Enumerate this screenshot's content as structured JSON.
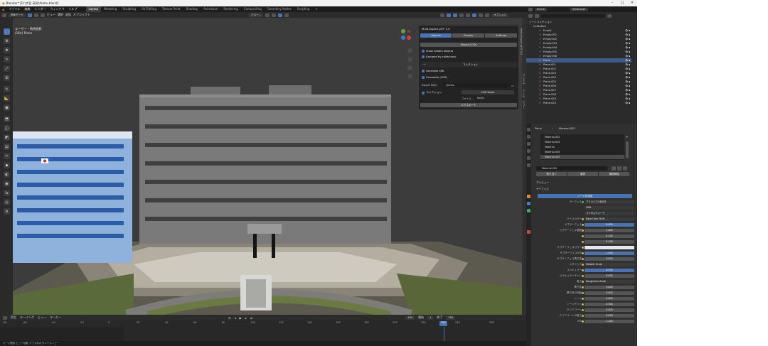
{
  "window": {
    "title": "Blender* [D:\\大宮 高岡\\fonbu.blend]"
  },
  "menu": {
    "items": [
      "ファイル",
      "編集",
      "レンダー",
      "ウィンドウ",
      "ヘルプ"
    ]
  },
  "workspaces": [
    "Layout",
    "Modeling",
    "Sculpting",
    "UV Editing",
    "Texture Paint",
    "Shading",
    "Animation",
    "Rendering",
    "Compositing",
    "Geometry Nodes",
    "Scripting"
  ],
  "header": {
    "mode": "物体モード",
    "menus": [
      "ビュー",
      "選択",
      "追加",
      "オブジェクト"
    ],
    "transform": "グロー...",
    "options": "オプション"
  },
  "viewport": {
    "view_name": "ユーザー・透視投影",
    "object_name": "(164) Plane"
  },
  "addon": {
    "title": "Multi-Export glTF 2.0",
    "tabs": [
      "Objects",
      "Presets",
      "Settings"
    ],
    "reload_button": "Reload LODs",
    "show_hidden": "Show hidden objects",
    "grouped": "Grouped by collections",
    "collection_header": "コレクション",
    "generate_xml": "Generate XML",
    "overwrite": "Overwrite (LOD)",
    "export_path_label": "Export Path:",
    "export_path": "//fonbu",
    "collection_label": "コレクション",
    "collection_value": "LOD Value",
    "file_label": "ファイル...",
    "file_value": "fonbu",
    "export_button": "エクスポート"
  },
  "sidebar_tabs": [
    "Multi-Export glTF 2.0",
    "アイテム",
    "ツール",
    "ビュー"
  ],
  "timeline": {
    "menus": [
      "再生",
      "キーイング",
      "ビュー",
      "マーカー"
    ],
    "ticks": [
      "-80",
      "-60",
      "-40",
      "-20",
      "0",
      "20",
      "40",
      "60",
      "80",
      "100",
      "120",
      "140",
      "160",
      "180",
      "200",
      "220",
      "240",
      "260"
    ],
    "current_frame": "164",
    "start_label": "開始",
    "start": "1",
    "end_label": "終了",
    "end": "250"
  },
  "statusbar": {
    "text": "ループ選択          ビュー回転          マウス右ボタンでメニュー"
  },
  "outliner": {
    "scene": "Scene",
    "view_layer": "ViewLayer",
    "root": "シーンコレクション",
    "collection": "Collection",
    "rows": [
      "Empty",
      "Empty.001",
      "Empty.002",
      "Empty.003",
      "Empty.004",
      "Empty.005",
      "Empty.006",
      "Plane",
      "Plane.001",
      "Plane.002",
      "Plane.003",
      "Plane.004",
      "Plane.005",
      "Plane.006",
      "Plane.007",
      "Plane.008",
      "Plane.009",
      "Plane.010"
    ],
    "selected_index": 7
  },
  "properties": {
    "breadcrumb_object": "Plane",
    "breadcrumb_material": "Material.005",
    "material_slots": [
      "Material.002",
      "Material.003",
      "Material",
      "Material.004",
      "Material.005"
    ],
    "material_name": "Material.005",
    "buttons": [
      "割り当て",
      "選択",
      "選択解除"
    ],
    "preview": "プレビュー",
    "surface_section": "サーフェス",
    "use_nodes": "ノードを使用",
    "surface_label": "サーフェス",
    "surface_value": "プリンシプルBSDF",
    "dist1": "GGX",
    "dist2": "ランダムウォーク",
    "rows": [
      {
        "label": "ベースカラー",
        "value": "Base Color RGB"
      },
      {
        "label": "サブサーフェス",
        "value": "0.000"
      },
      {
        "label": "サブサーフェス範囲",
        "value": "1.000"
      },
      {
        "label": "",
        "value": "0.200"
      },
      {
        "label": "",
        "value": "0.100"
      },
      {
        "label": "サブサーフェスカラー",
        "value": ""
      },
      {
        "label": "サブサーフェスIOR",
        "value": "1.400"
      },
      {
        "label": "サブサーフェス異方性",
        "value": "0.000"
      },
      {
        "label": "メタリック",
        "value": "Metallic Scale"
      },
      {
        "label": "スペキュラー",
        "value": "0.500"
      },
      {
        "label": "スペキュラーチント",
        "value": "0.000"
      },
      {
        "label": "粗さ",
        "value": "Roughness Scale"
      },
      {
        "label": "異方性",
        "value": "0.000"
      },
      {
        "label": "異方性の回転",
        "value": "0.000"
      },
      {
        "label": "シーン",
        "value": "0.000"
      },
      {
        "label": "シーンチント",
        "value": "0.500"
      },
      {
        "label": "クリアコート",
        "value": "0.000"
      },
      {
        "label": "クリアコートの粗さ",
        "value": "0.030"
      },
      {
        "label": "IOR",
        "value": "1.450"
      }
    ]
  }
}
